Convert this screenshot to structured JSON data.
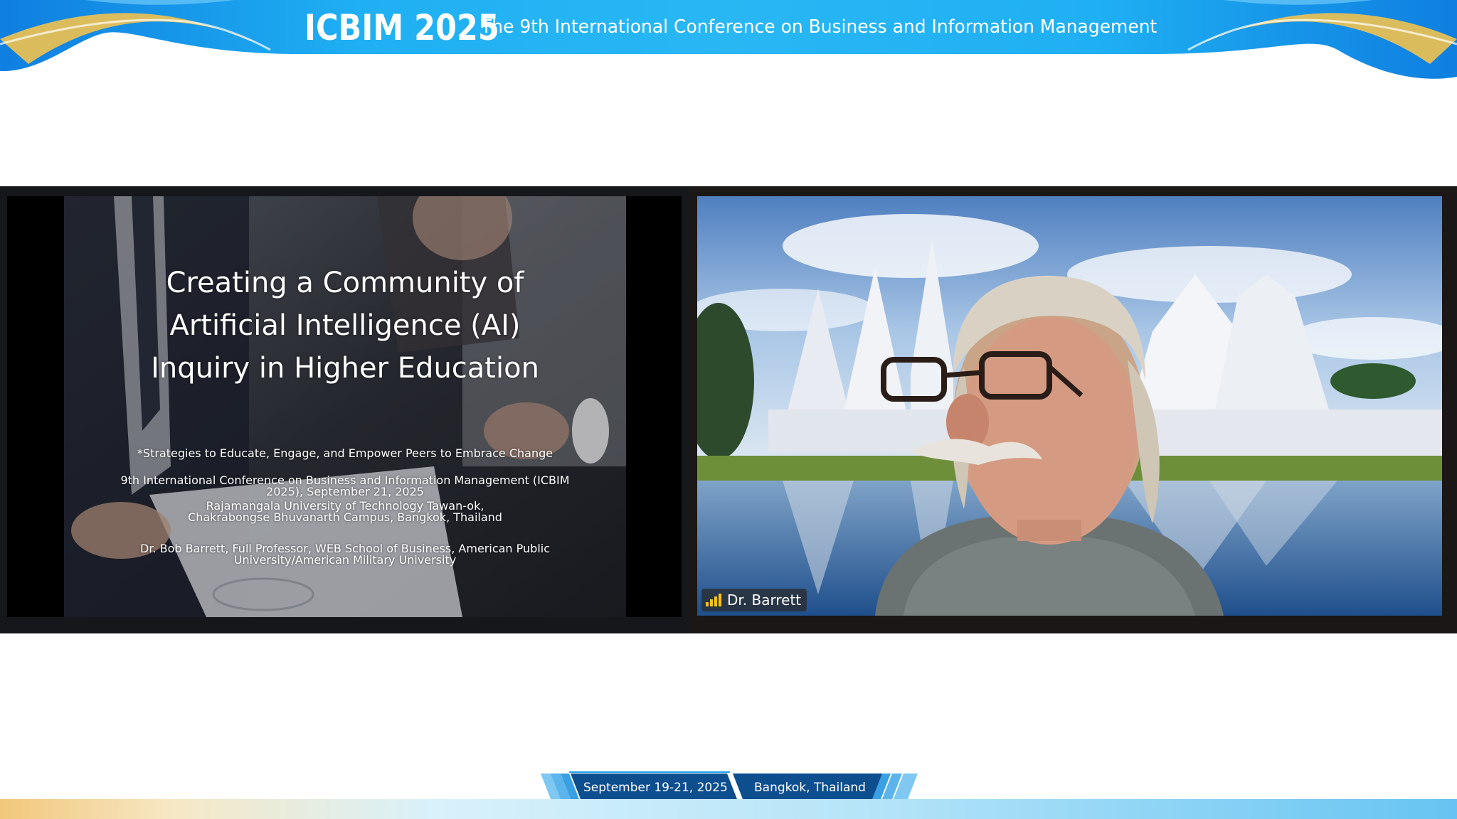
{
  "banner": {
    "title": "ICBIM 2025",
    "subtitle": "The 9th International Conference on Business and Information Management"
  },
  "slide": {
    "title_lines": [
      "Creating a Community of",
      "Artificial Intelligence (AI)",
      "Inquiry in Higher Education"
    ],
    "tagline": "*Strategies to Educate, Engage, and Empower Peers to Embrace Change",
    "conference_lines": [
      "9th International Conference on Business and Information Management (ICBIM",
      "2025), September 21, 2025",
      "Rajamangala University of Technology Tawan-ok,",
      "Chakrabongse Bhuvanarth Campus, Bangkok, Thailand"
    ],
    "author_lines": [
      "Dr. Bob Barrett, Full Professor, WEB School of Business, American Public",
      "University/American Military University"
    ]
  },
  "participant": {
    "name": "Dr. Barrett",
    "signal_icon": "signal-bars-icon"
  },
  "footer": {
    "dates": "September 19-21, 2025",
    "location": "Bangkok, Thailand"
  },
  "colors": {
    "banner_blue": "#1aa3ef",
    "banner_gold": "#f2c24e",
    "footer_navy": "#0d4e8f"
  }
}
